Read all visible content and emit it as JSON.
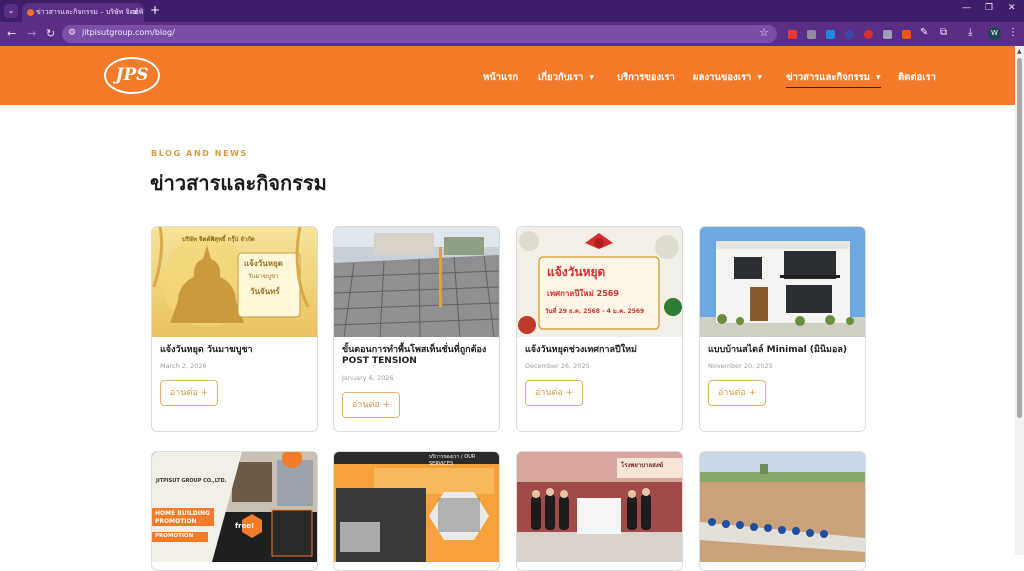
{
  "browser": {
    "tab_title": "ข่าวสารและกิจกรรม – บริษัท จิตต์พิ…",
    "url": "jitpisutgroup.com/blog/",
    "profile_initial": "W"
  },
  "site": {
    "logo_text": "JPS",
    "nav": [
      {
        "label": "หน้าแรก"
      },
      {
        "label": "เกี่ยวกับเรา"
      },
      {
        "label": "บริการของเรา"
      },
      {
        "label": "ผลงานของเรา"
      },
      {
        "label": "ข่าวสารและกิจกรรม"
      },
      {
        "label": "ติดต่อเรา"
      }
    ],
    "colors": {
      "brand_orange": "#f47b2a",
      "accent_gold": "#d39c3e",
      "browser_purple": "#5b2e86"
    }
  },
  "main": {
    "eyebrow": "BLOG AND NEWS",
    "title": "ข่าวสารและกิจกรรม",
    "read_more": "อ่านต่อ +",
    "posts": [
      {
        "title": "แจ้งวันหยุด วันมาฆบูชา",
        "date": "March 2, 2026",
        "thumb": {
          "company": "บริษัท จิตต์พิสุทธิ์ กรุ๊ป จำกัด",
          "heading": "แจ้งวันหยุด",
          "sub": "วันมาฆบูชา",
          "day": "วันจันทร์"
        }
      },
      {
        "title": "ขั้นตอนการทำพื้นโพสเท็นชั่นที่ถูกต้อง POST TENSION",
        "date": "January 6, 2026"
      },
      {
        "title": "แจ้งวันหยุดช่วงเทศกาลปีใหม่",
        "date": "December 26, 2025",
        "thumb": {
          "heading": "แจ้งวันหยุด",
          "sub": "เทศกาลปีใหม่ 2569",
          "range": "วันที่ 29 ธ.ค. 2568 - 4 ม.ค. 2569"
        }
      },
      {
        "title": "แบบบ้านสไตล์ Minimal (มินิมอล)",
        "date": "November 20, 2025"
      },
      {
        "title": "",
        "date": "",
        "thumb": {
          "company": "JITPISUT GROUP CO.,LTD.",
          "headline": "HOME BUILDING PROMOTION",
          "tag": "PROMOTION",
          "badge": "free!"
        }
      },
      {
        "title": "",
        "date": "",
        "thumb": {
          "tag": "บริการของเรา / OUR SERVICES"
        }
      },
      {
        "title": "",
        "date": "",
        "thumb": {
          "sign": "โรงพยาบาลสงฆ์"
        }
      },
      {
        "title": "",
        "date": ""
      }
    ]
  }
}
